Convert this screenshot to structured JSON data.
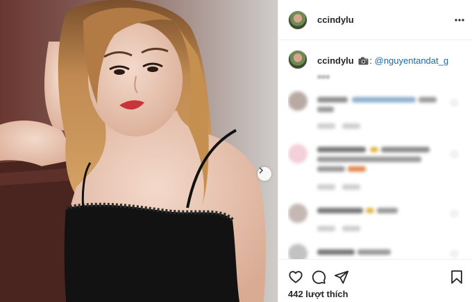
{
  "post": {
    "username": "ccindylu",
    "caption_username": "ccindylu",
    "caption_separator": ":",
    "caption_mention": "@nguyentandat_g",
    "likes_text": "442 lượt thích"
  },
  "icons": {
    "more": "more-options-icon",
    "camera": "camera-emoji-icon",
    "next": "chevron-right-icon",
    "like": "heart-icon",
    "comment": "comment-bubble-icon",
    "share": "paper-plane-icon",
    "save": "bookmark-icon"
  },
  "colors": {
    "text": "#262626",
    "mention": "#1a6aa6",
    "border": "#efefef",
    "muted": "#aaaaaa"
  }
}
